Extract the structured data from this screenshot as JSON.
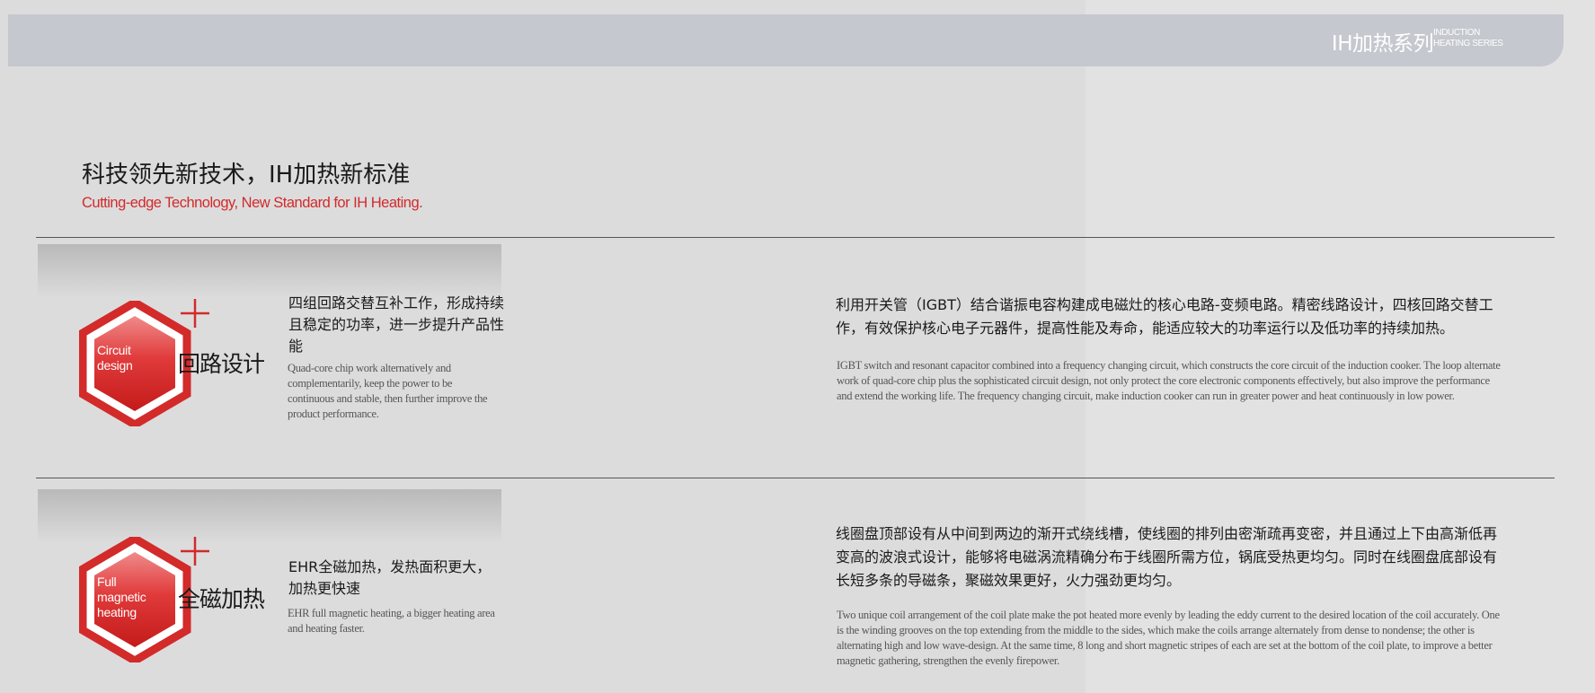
{
  "header": {
    "series_title": "IH加热系列",
    "series_subtitle_line1": "INDUCTION",
    "series_subtitle_line2": "HEATING SERIES"
  },
  "intro": {
    "title_cn": "科技领先新技术，IH加热新标准",
    "title_en": "Cutting-edge Technology, New Standard for IH Heating."
  },
  "colors": {
    "accent_red": "#d32a2a",
    "header_bar": "#c5c8ce"
  },
  "features": [
    {
      "icon": "hexagon-plus-icon",
      "badge_lines": [
        "Circuit",
        "design"
      ],
      "title_cn": "回路设计",
      "summary_cn": "四组回路交替互补工作，形成持续且稳定的功率，进一步提升产品性能",
      "summary_en": "Quad-core chip work alternatively and complementarily, keep the power to be continuous and stable, then further improve the product performance.",
      "detail_cn": "利用开关管（IGBT）结合谐振电容构建成电磁灶的核心电路-变频电路。精密线路设计，四核回路交替工作，有效保护核心电子元器件，提高性能及寿命，能适应较大的功率运行以及低功率的持续加热。",
      "detail_en": "IGBT switch and resonant capacitor combined into a frequency changing circuit, which constructs the core circuit of the induction cooker. The loop alternate work of quad-core chip plus the sophisticated circuit design, not only protect the core electronic components effectively, but also improve the performance and extend the working life. The frequency changing circuit, make induction cooker can run in greater power and heat continuously in low power."
    },
    {
      "icon": "hexagon-plus-icon",
      "badge_lines": [
        "Full",
        "magnetic",
        "heating"
      ],
      "title_cn": "全磁加热",
      "summary_cn": "EHR全磁加热，发热面积更大，加热更快速",
      "summary_en": "EHR full magnetic heating, a bigger heating area and heating faster.",
      "detail_cn": "线圈盘顶部设有从中间到两边的渐开式绕线槽，使线圈的排列由密渐疏再变密，并且通过上下由高渐低再变高的波浪式设计，能够将电磁涡流精确分布于线圈所需方位，锅底受热更均匀。同时在线圈盘底部设有长短多条的导磁条，聚磁效果更好，火力强劲更均匀。",
      "detail_en": "Two unique coil arrangement of the coil plate make the pot heated more evenly by leading the eddy current to the desired location of the coil accurately. One is the winding grooves on the top extending from the middle to the sides, which make the coils arrange alternately from dense to nondense; the other is alternating high and low wave-design. At the same time, 8 long and short magnetic stripes of each are set at the bottom of the coil plate, to improve a better magnetic gathering, strengthen the evenly firepower."
    }
  ]
}
